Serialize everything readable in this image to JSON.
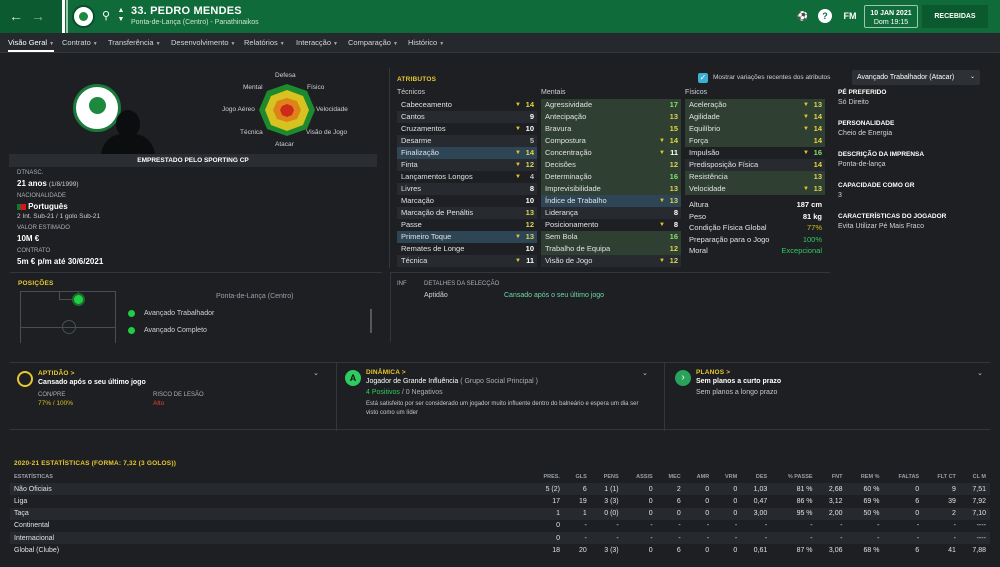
{
  "header": {
    "player_name": "33. PEDRO MENDES",
    "subtitle": "Ponta-de-Lança (Centro) - Panathinaikos",
    "fm_label": "FM",
    "date": "10 JAN 2021",
    "day_time": "Dom 19:15",
    "inbox_label": "RECEBIDAS"
  },
  "tabs": [
    {
      "label": "Visão Geral"
    },
    {
      "label": "Contrato"
    },
    {
      "label": "Transferência"
    },
    {
      "label": "Desenvolvimento"
    },
    {
      "label": "Relatórios"
    },
    {
      "label": "Interacção"
    },
    {
      "label": "Comparação"
    },
    {
      "label": "Histórico"
    }
  ],
  "profile": {
    "loan_status": "EMPRESTADO PELO SPORTING CP",
    "dob_label": "DTNASC.",
    "age": "21 anos",
    "dob": "(1/8/1999)",
    "nationality_label": "NACIONALIDADE",
    "nationality": "Português",
    "caps": "2 Int. Sub-21 / 1 golo Sub-21",
    "value_label": "VALOR ESTIMADO",
    "value": "10M €",
    "contract_label": "CONTRATO",
    "contract": "5m € p/m até 30/6/2021"
  },
  "radar": {
    "labels": [
      "Defesa",
      "Físico",
      "Velocidade",
      "Visão de Jogo",
      "Atacar",
      "Técnica",
      "Jogo Aéreo",
      "Mental"
    ]
  },
  "attributes": {
    "title": "ATRIBUTOS",
    "show_changes": "Mostrar variações recentes dos atributos",
    "role_select": "Avançado Trabalhador (Atacar)",
    "headers": {
      "tech": "Técnicos",
      "mental": "Mentais",
      "physical": "Físicos"
    },
    "tech": [
      {
        "n": "Cabeceamento",
        "v": "14",
        "a": "▼"
      },
      {
        "n": "Cantos",
        "v": "9",
        "a": ""
      },
      {
        "n": "Cruzamentos",
        "v": "10",
        "a": "▼"
      },
      {
        "n": "Desarme",
        "v": "5",
        "a": ""
      },
      {
        "n": "Finalização",
        "v": "14",
        "a": "▼"
      },
      {
        "n": "Finta",
        "v": "12",
        "a": "▼"
      },
      {
        "n": "Lançamentos Longos",
        "v": "4",
        "a": "▼"
      },
      {
        "n": "Livres",
        "v": "8",
        "a": ""
      },
      {
        "n": "Marcação",
        "v": "10",
        "a": ""
      },
      {
        "n": "Marcação de Penáltis",
        "v": "13",
        "a": ""
      },
      {
        "n": "Passe",
        "v": "12",
        "a": ""
      },
      {
        "n": "Primeiro Toque",
        "v": "13",
        "a": "▼"
      },
      {
        "n": "Remates de Longe",
        "v": "10",
        "a": ""
      },
      {
        "n": "Técnica",
        "v": "11",
        "a": "▼"
      }
    ],
    "mental": [
      {
        "n": "Agressividade",
        "v": "17",
        "a": ""
      },
      {
        "n": "Antecipação",
        "v": "13",
        "a": ""
      },
      {
        "n": "Bravura",
        "v": "15",
        "a": ""
      },
      {
        "n": "Compostura",
        "v": "14",
        "a": "▼"
      },
      {
        "n": "Concentração",
        "v": "11",
        "a": "▼"
      },
      {
        "n": "Decisões",
        "v": "12",
        "a": ""
      },
      {
        "n": "Determinação",
        "v": "16",
        "a": ""
      },
      {
        "n": "Imprevisibilidade",
        "v": "13",
        "a": ""
      },
      {
        "n": "Índice de Trabalho",
        "v": "13",
        "a": "▼"
      },
      {
        "n": "Liderança",
        "v": "8",
        "a": ""
      },
      {
        "n": "Posicionamento",
        "v": "8",
        "a": "▼"
      },
      {
        "n": "Sem Bola",
        "v": "16",
        "a": ""
      },
      {
        "n": "Trabalho de Equipa",
        "v": "12",
        "a": ""
      },
      {
        "n": "Visão de Jogo",
        "v": "12",
        "a": "▼"
      }
    ],
    "physical": [
      {
        "n": "Aceleração",
        "v": "13",
        "a": "▼"
      },
      {
        "n": "Agilidade",
        "v": "14",
        "a": "▼"
      },
      {
        "n": "Equilíbrio",
        "v": "14",
        "a": "▼"
      },
      {
        "n": "Força",
        "v": "14",
        "a": ""
      },
      {
        "n": "Impulsão",
        "v": "16",
        "a": "▼"
      },
      {
        "n": "Predisposição Física",
        "v": "14",
        "a": ""
      },
      {
        "n": "Resistência",
        "v": "13",
        "a": ""
      },
      {
        "n": "Velocidade",
        "v": "13",
        "a": "▼"
      }
    ],
    "body": [
      {
        "n": "Altura",
        "v": "187 cm"
      },
      {
        "n": "Peso",
        "v": "81 kg"
      },
      {
        "n": "Condição Física Global",
        "v": "77%"
      },
      {
        "n": "Preparação para o Jogo",
        "v": "100%"
      },
      {
        "n": "Moral",
        "v": "Excepcional"
      }
    ]
  },
  "info": [
    {
      "label": "PÉ PREFERIDO",
      "value": "Só Direito"
    },
    {
      "label": "PERSONALIDADE",
      "value": "Cheio de Energia"
    },
    {
      "label": "DESCRIÇÃO DA IMPRENSA",
      "value": "Ponta-de-lança"
    },
    {
      "label": "CAPACIDADE COMO GR",
      "value": "3"
    },
    {
      "label": "CARACTERÍSTICAS DO JOGADOR",
      "value": "Evita Utilizar Pé Mais Fraco"
    }
  ],
  "positions": {
    "title": "POSIÇÕES",
    "main": "Ponta-de-Lança (Centro)",
    "roles": [
      "Avançado Trabalhador",
      "Avançado Completo"
    ]
  },
  "selection": {
    "col1": "INF",
    "col2": "DETALHES DA SELECÇÃO",
    "label": "Aptidão",
    "value": "Cansado após o seu último jogo"
  },
  "cards": {
    "aptidao": {
      "title": "APTIDÃO >",
      "text": "Cansado após o seu último jogo",
      "con_label": "CON/PRE",
      "con": "77% / 100%",
      "risk_label": "RISCO DE LESÃO",
      "risk": "Alto"
    },
    "dinamica": {
      "title": "DINÂMICA >",
      "line1": "Jogador de Grande Influência",
      "line1b": "( Grupo Social Principal )",
      "pos": "4 Positivos",
      "neg": "0 Negativos",
      "desc": "Está satisfeito por ser considerado um jogador muito influente dentro do balneário e espera um dia ser visto como um líder"
    },
    "planos": {
      "title": "PLANOS >",
      "line1": "Sem planos a curto prazo",
      "line2": "Sem planos a longo prazo"
    }
  },
  "stats": {
    "title": "2020-21 ESTATÍSTICAS (FORMA: 7,32 (3 GOLOS))",
    "headers": [
      "ESTATÍSTICAS",
      "PRES.",
      "GLS",
      "PENS",
      "ASSIS",
      "MEC",
      "AMR",
      "VRM",
      "DES",
      "% PASSE",
      "FNT",
      "REM %",
      "FALTAS",
      "FLT CT",
      "CL M"
    ],
    "rows": [
      [
        "Não Oficiais",
        "5 (2)",
        "6",
        "1 (1)",
        "0",
        "2",
        "0",
        "0",
        "1,03",
        "81 %",
        "2,68",
        "60 %",
        "0",
        "9",
        "7,51"
      ],
      [
        "Liga",
        "17",
        "19",
        "3 (3)",
        "0",
        "6",
        "0",
        "0",
        "0,47",
        "86 %",
        "3,12",
        "69 %",
        "6",
        "39",
        "7,92"
      ],
      [
        "Taça",
        "1",
        "1",
        "0 (0)",
        "0",
        "0",
        "0",
        "0",
        "3,00",
        "95 %",
        "2,00",
        "50 %",
        "0",
        "2",
        "7,10"
      ],
      [
        "Continental",
        "0",
        "-",
        "-",
        "-",
        "-",
        "-",
        "-",
        "-",
        "-",
        "-",
        "-",
        "-",
        "-",
        "----"
      ],
      [
        "Internacional",
        "0",
        "-",
        "-",
        "-",
        "-",
        "-",
        "-",
        "-",
        "-",
        "-",
        "-",
        "-",
        "-",
        "----"
      ],
      [
        "Global (Clube)",
        "18",
        "20",
        "3 (3)",
        "0",
        "6",
        "0",
        "0",
        "0,61",
        "87 %",
        "3,06",
        "68 %",
        "6",
        "41",
        "7,88"
      ]
    ]
  }
}
